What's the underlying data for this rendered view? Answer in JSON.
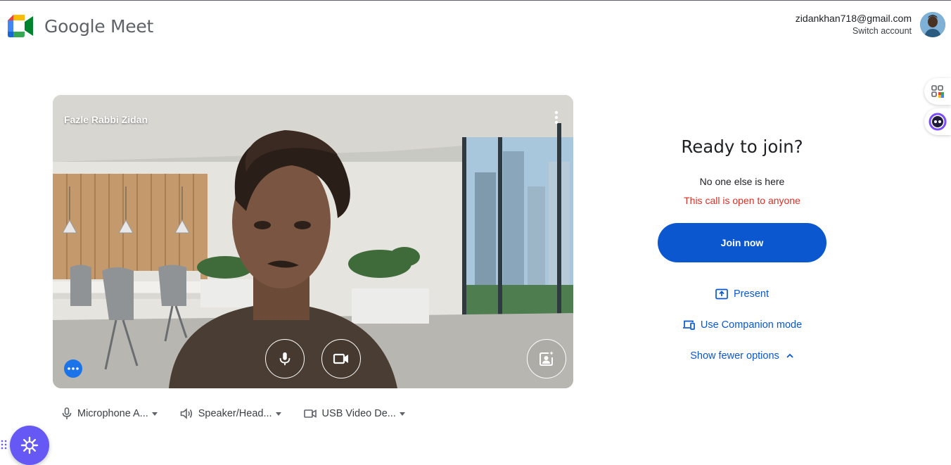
{
  "header": {
    "brand": "Google Meet",
    "account_email": "zidankhan718@gmail.com",
    "switch_account": "Switch account"
  },
  "preview": {
    "participant_name": "Fazle Rabbi Zidan"
  },
  "devices": [
    {
      "icon": "microphone-icon",
      "label": "Microphone A..."
    },
    {
      "icon": "speaker-icon",
      "label": "Speaker/Head..."
    },
    {
      "icon": "camera-icon",
      "label": "USB Video De..."
    }
  ],
  "join_panel": {
    "title": "Ready to join?",
    "subtitle": "No one else is here",
    "warning": "This call is open to anyone",
    "join_button": "Join now",
    "present": "Present",
    "companion": "Use Companion mode",
    "fewer_options": "Show fewer options"
  },
  "colors": {
    "primary": "#0b57d0",
    "warning": "#d93025",
    "assistant": "#6558f5"
  }
}
